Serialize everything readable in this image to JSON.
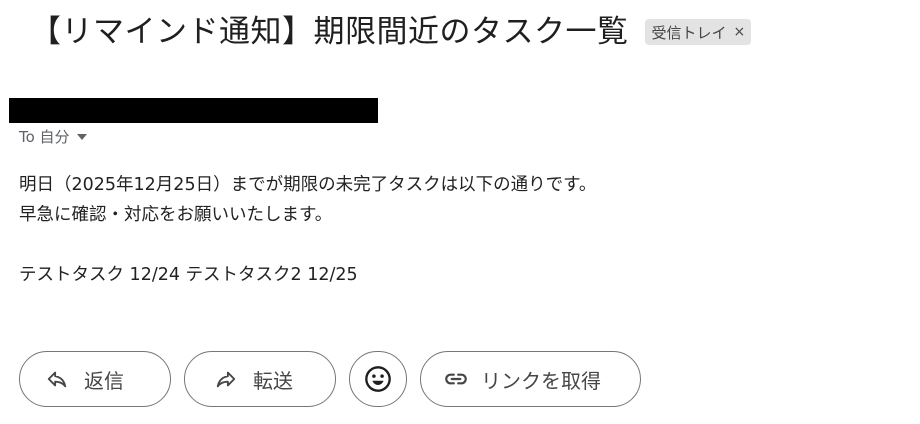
{
  "email": {
    "subject": "【リマインド通知】期限間近のタスク一覧",
    "label_chip": {
      "text": "受信トレイ",
      "close_glyph": "×"
    },
    "recipient": "To 自分",
    "body_lines": [
      "明日（2025年12月25日）までが期限の未完了タスクは以下の通りです。",
      "早急に確認・対応をお願いいたします。"
    ],
    "task_line": "テストタスク 12/24 テストタスク2 12/25"
  },
  "actions": {
    "reply_label": "返信",
    "forward_label": "転送",
    "link_label": "リンクを取得"
  },
  "icons": {
    "reply": "reply-arrow-icon",
    "forward": "forward-arrow-icon",
    "emoji": "smiley-icon",
    "link": "link-icon",
    "recipient_dropdown": "caret-down-icon"
  },
  "colors": {
    "redaction": "#000000",
    "chip_background": "#e3e3e3",
    "button_border": "#747775"
  }
}
